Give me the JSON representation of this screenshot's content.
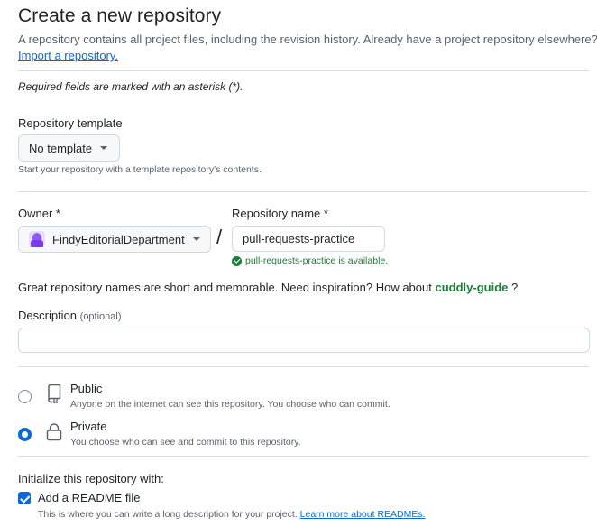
{
  "header": {
    "title": "Create a new repository",
    "intro": "A repository contains all project files, including the revision history. Already have a project repository elsewhere?",
    "import_link": "Import a repository."
  },
  "required_note": "Required fields are marked with an asterisk (*).",
  "template": {
    "label": "Repository template",
    "selected": "No template",
    "hint": "Start your repository with a template repository's contents."
  },
  "owner": {
    "label": "Owner *",
    "selected": "FindyEditorialDepartment",
    "avatar_icon": "org-avatar"
  },
  "separator": "/",
  "repo_name": {
    "label": "Repository name *",
    "value": "pull-requests-practice",
    "availability": "pull-requests-practice is available."
  },
  "inspiration": {
    "text": "Great repository names are short and memorable. Need inspiration? How about",
    "suggestion": "cuddly-guide",
    "suffix": "?"
  },
  "description": {
    "label": "Description",
    "optional": "(optional)",
    "value": ""
  },
  "visibility": {
    "selected": "private",
    "options": [
      {
        "key": "public",
        "title": "Public",
        "desc": "Anyone on the internet can see this repository. You choose who can commit.",
        "icon": "repo-icon"
      },
      {
        "key": "private",
        "title": "Private",
        "desc": "You choose who can see and commit to this repository.",
        "icon": "lock-icon"
      }
    ]
  },
  "init": {
    "label": "Initialize this repository with:",
    "readme_label": "Add a README file",
    "readme_checked": true,
    "readme_desc": "This is where you can write a long description for your project.",
    "readme_link": "Learn more about READMEs."
  },
  "colors": {
    "accent": "#0969da",
    "success": "#1a7f37",
    "muted": "#59636e"
  }
}
